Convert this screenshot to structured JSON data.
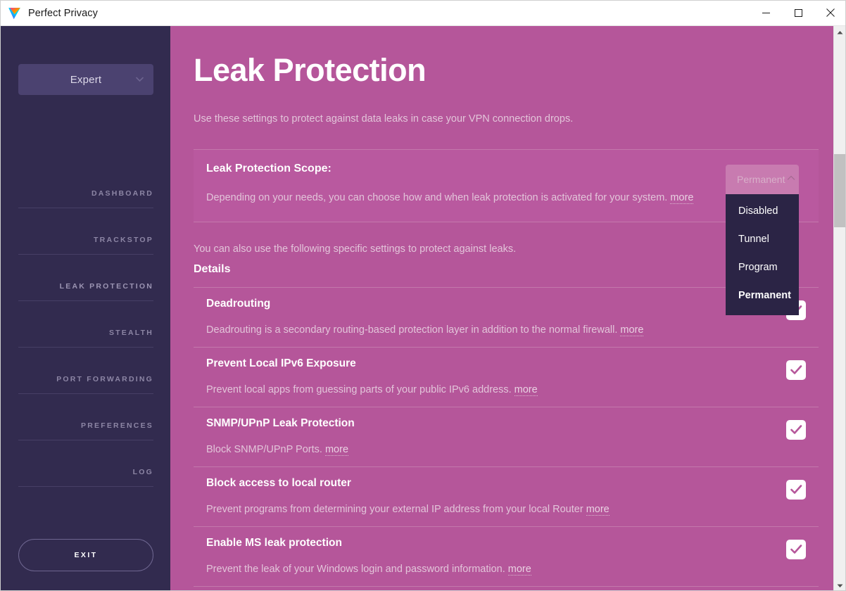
{
  "window": {
    "title": "Perfect Privacy",
    "logo_icon": "perfect-privacy-logo-icon",
    "minimize_icon": "minimize-icon",
    "maximize_icon": "maximize-icon",
    "close_icon": "close-icon"
  },
  "sidebar": {
    "mode_selector": {
      "value": "Expert",
      "chevron_icon": "chevron-down-icon"
    },
    "items": [
      {
        "label": "DASHBOARD",
        "active": false
      },
      {
        "label": "TRACKSTOP",
        "active": false
      },
      {
        "label": "LEAK PROTECTION",
        "active": true
      },
      {
        "label": "STEALTH",
        "active": false
      },
      {
        "label": "PORT FORWARDING",
        "active": false
      },
      {
        "label": "PREFERENCES",
        "active": false
      },
      {
        "label": "LOG",
        "active": false
      }
    ],
    "exit_label": "EXIT"
  },
  "main": {
    "title": "Leak Protection",
    "subtitle": "Use these settings to protect against data leaks in case your VPN connection drops.",
    "scope_card": {
      "title": "Leak Protection Scope:",
      "description": "Depending on your needs, you can choose how and when leak protection is activated for your system.",
      "more_label": "more"
    },
    "mid_note": "You can also use the following specific settings to protect against leaks.",
    "details_heading": "Details",
    "settings": [
      {
        "name": "Deadrouting",
        "description": "Deadrouting is a secondary routing-based protection layer in addition to the normal firewall.",
        "more_label": "more",
        "checked": true
      },
      {
        "name": "Prevent Local IPv6 Exposure",
        "description": "Prevent local apps from guessing parts of your public IPv6 address.",
        "more_label": "more",
        "checked": true
      },
      {
        "name": "SNMP/UPnP Leak Protection",
        "description": "Block SNMP/UPnP Ports.",
        "more_label": "more",
        "checked": true
      },
      {
        "name": "Block access to local router",
        "description": "Prevent programs from determining your external IP address from your local Router",
        "more_label": "more",
        "checked": true
      },
      {
        "name": "Enable MS leak protection",
        "description": "Prevent the leak of your Windows login and password information.",
        "more_label": "more",
        "checked": true
      }
    ]
  },
  "dropdown": {
    "selected_value": "Permanent",
    "chevron_icon": "chevron-up-icon",
    "options": [
      {
        "label": "Disabled",
        "selected": false
      },
      {
        "label": "Tunnel",
        "selected": false
      },
      {
        "label": "Program",
        "selected": false
      },
      {
        "label": "Permanent",
        "selected": true
      }
    ]
  },
  "scrollbar": {
    "up_arrow_icon": "scroll-up-arrow-icon",
    "down_arrow_icon": "scroll-down-arrow-icon"
  },
  "colors": {
    "sidebar_bg": "#322b4f",
    "content_bg": "#b5569a",
    "dropdown_bg": "#2b2445",
    "accent_check": "#b5569a",
    "muted_text": "#e2c4d9"
  }
}
